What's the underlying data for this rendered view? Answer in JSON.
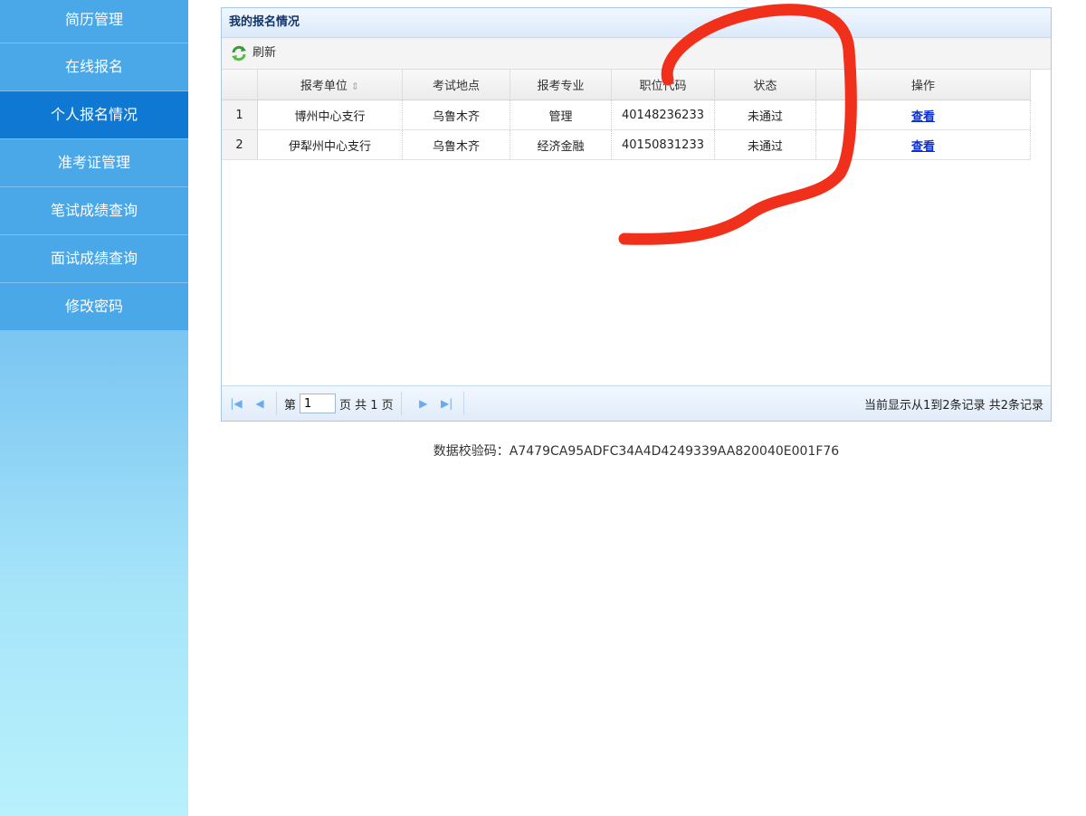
{
  "sidebar": {
    "items": [
      {
        "label": "简历管理"
      },
      {
        "label": "在线报名"
      },
      {
        "label": "个人报名情况"
      },
      {
        "label": "准考证管理"
      },
      {
        "label": "笔试成绩查询"
      },
      {
        "label": "面试成绩查询"
      },
      {
        "label": "修改密码"
      }
    ]
  },
  "panel": {
    "title": "我的报名情况",
    "refresh_label": "刷新"
  },
  "table": {
    "columns": [
      "报考单位",
      "考试地点",
      "报考专业",
      "职位代码",
      "状态",
      "操作"
    ],
    "rows": [
      {
        "num": "1",
        "unit": "博州中心支行",
        "location": "乌鲁木齐",
        "major": "管理",
        "code": "40148236233",
        "status": "未通过",
        "action": "查看"
      },
      {
        "num": "2",
        "unit": "伊犁州中心支行",
        "location": "乌鲁木齐",
        "major": "经济金融",
        "code": "40150831233",
        "status": "未通过",
        "action": "查看"
      }
    ]
  },
  "pager": {
    "page_prefix": "第",
    "page_value": "1",
    "page_suffix": "页 共 1 页",
    "info": "当前显示从1到2条记录 共2条记录"
  },
  "footer": {
    "checksum": "数据校验码：A7479CA95ADFC34A4D4249339AA820040E001F76"
  },
  "colors": {
    "sidebar_item": "#4aa7e8",
    "sidebar_active": "#0f78d2",
    "link": "#0c2fd1",
    "annotation": "#f0301a"
  }
}
